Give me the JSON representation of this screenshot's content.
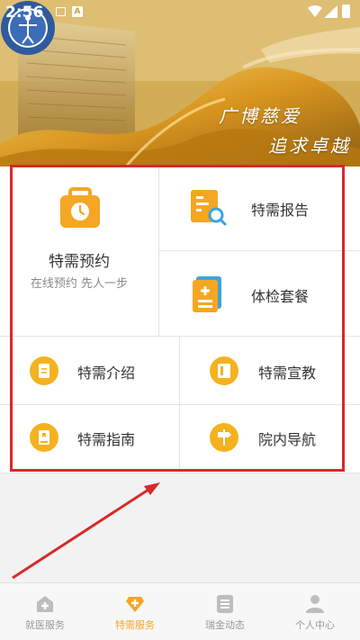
{
  "status": {
    "time": "2:56"
  },
  "banner": {
    "slogan_line1": "广博慈爱",
    "slogan_line2": "追求卓越"
  },
  "services": {
    "featured": {
      "title": "特需预约",
      "subtitle": "在线预约 先人一步"
    },
    "report": "特需报告",
    "checkup": "体检套餐",
    "intro": "特需介绍",
    "education": "特需宣教",
    "guide": "特需指南",
    "navigation": "院内导航"
  },
  "tabs": [
    {
      "label": "就医服务",
      "icon": "hospital-icon"
    },
    {
      "label": "特需服务",
      "icon": "diamond-plus-icon",
      "active": true
    },
    {
      "label": "瑞金动态",
      "icon": "news-icon"
    },
    {
      "label": "个人中心",
      "icon": "person-icon"
    }
  ],
  "colors": {
    "accent": "#f5a623",
    "icon_orange": "#f5b21e",
    "highlight": "#d62a2a"
  }
}
